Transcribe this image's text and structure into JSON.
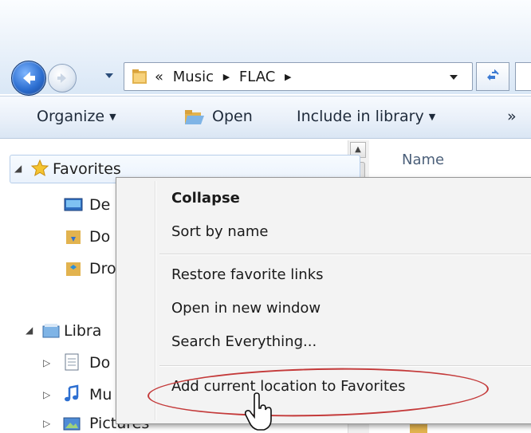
{
  "address": {
    "overflow_chevron": "«",
    "crumbs": [
      "Music",
      "FLAC"
    ]
  },
  "toolbar": {
    "organize": "Organize",
    "open": "Open",
    "include": "Include in library",
    "more": "»"
  },
  "columns": {
    "name": "Name"
  },
  "nav": {
    "favorites": "Favorites",
    "fav_children": [
      "De",
      "Do",
      "Dro"
    ],
    "libraries": "Libra",
    "lib_children": [
      "Do",
      "Mu",
      "Pictures"
    ]
  },
  "context_menu": {
    "items": [
      "Collapse",
      "Sort by name",
      "Restore favorite links",
      "Open in new window",
      "Search Everything...",
      "Add current location to Favorites"
    ]
  },
  "colors": {
    "annotation": "#c43a3a",
    "toolbar": "#e9f0f9",
    "menu": "#f3f3f3"
  }
}
